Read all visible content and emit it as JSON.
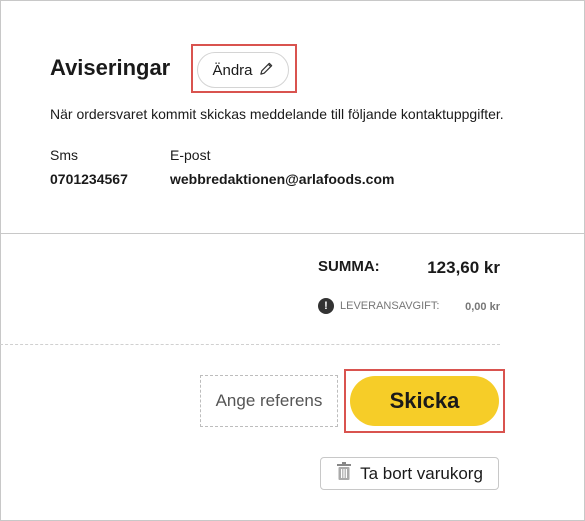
{
  "notifications": {
    "title": "Aviseringar",
    "edit_label": "Ändra",
    "intro": "När ordersvaret kommit skickas meddelande till följande kontaktuppgifter.",
    "sms_label": "Sms",
    "sms_value": "0701234567",
    "email_label": "E-post",
    "email_value": "webbredaktionen@arlafoods.com"
  },
  "summary": {
    "total_label": "SUMMA:",
    "total_value": "123,60 kr",
    "fee_label": "LEVERANSAVGIFT:",
    "fee_value": "0,00 kr"
  },
  "actions": {
    "reference_label": "Ange referens",
    "send_label": "Skicka",
    "remove_cart_label": "Ta bort varukorg"
  },
  "colors": {
    "accent_yellow": "#f6cd28",
    "highlight_red": "#d9534f"
  },
  "icons": {
    "edit": "pencil-icon",
    "info": "info-icon",
    "remove": "trash-icon"
  }
}
